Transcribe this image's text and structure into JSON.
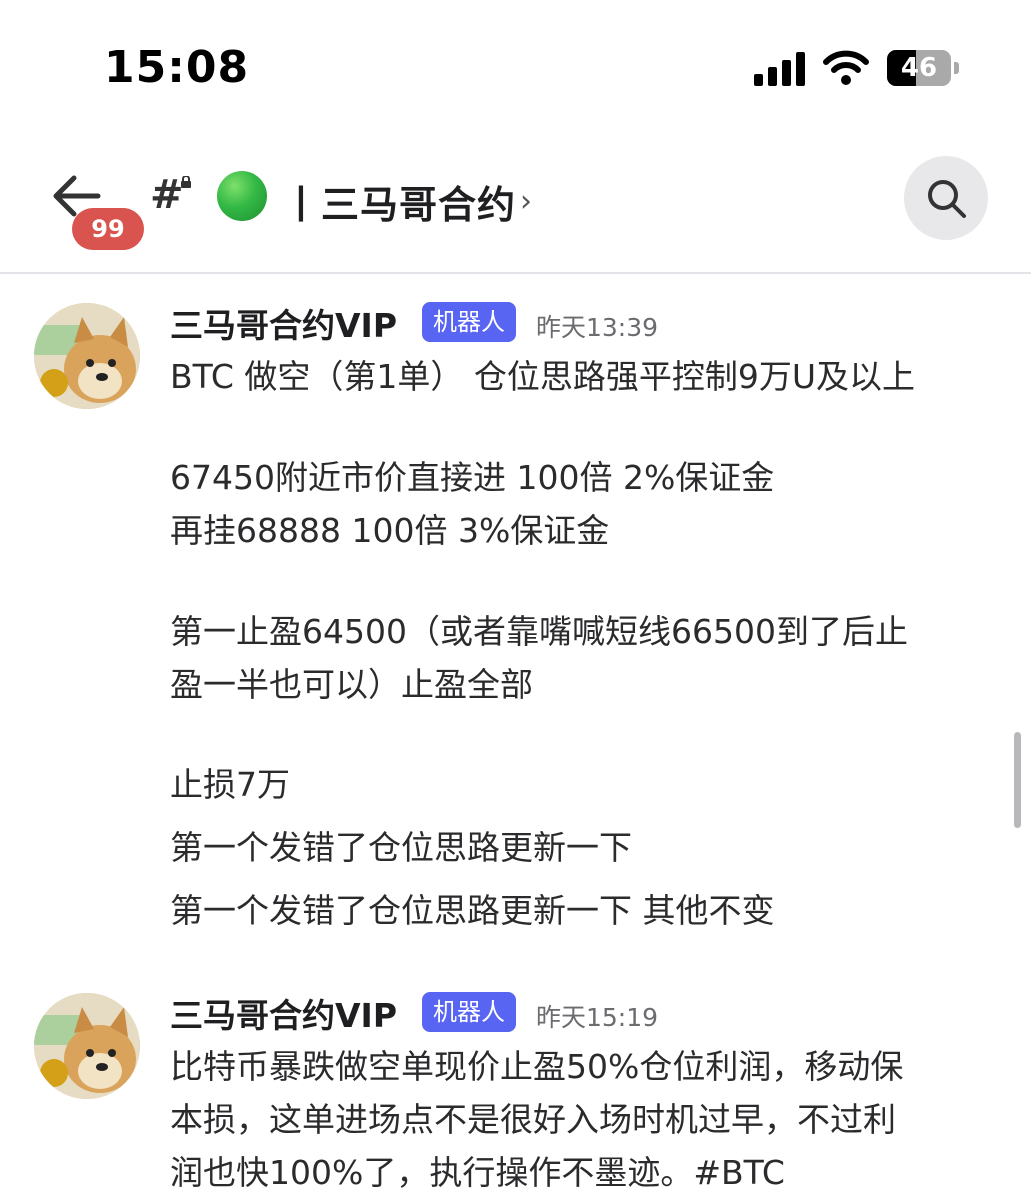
{
  "status_bar": {
    "time": "15:08",
    "battery": "46"
  },
  "header": {
    "unread_count": "99",
    "channel_name": "丨三马哥合约",
    "chevron": "›"
  },
  "messages": [
    {
      "author": "三马哥合约VIP",
      "badge": "机器人",
      "timestamp": "昨天13:39",
      "lines": [
        "BTC  做空（第1单）   仓位思路强平控制9万U及以上",
        "67450附近市价直接进     100倍  2%保证金",
        "再挂68888   100倍  3%保证金",
        "第一止盈64500（或者靠嘴喊短线66500到了后止",
        "盈一半也可以）止盈全部",
        "止损7万",
        "第一个发错了仓位思路更新一下",
        "第一个发错了仓位思路更新一下 其他不变"
      ]
    },
    {
      "author": "三马哥合约VIP",
      "badge": "机器人",
      "timestamp": "昨天15:19",
      "lines": [
        "比特币暴跌做空单现价止盈50%仓位利润，移动保",
        "本损，这单进场点不是很好入场时机过早，不过利",
        "润也快100%了，执行操作不墨迹。#BTC"
      ]
    }
  ],
  "colors": {
    "bot_badge": "#5865f2",
    "unread_badge": "#d9534f",
    "online_dot": "#33b845"
  }
}
